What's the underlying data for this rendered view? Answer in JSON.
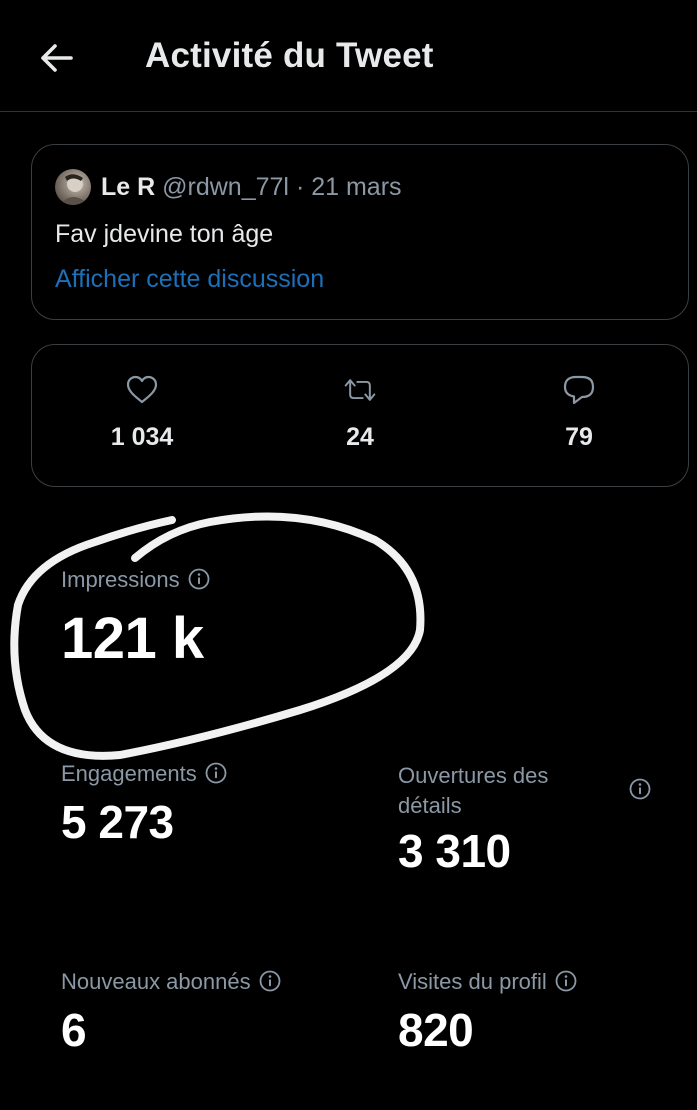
{
  "header": {
    "back_icon": "arrow-left-icon",
    "title": "Activité du Tweet"
  },
  "tweet": {
    "avatar_icon": "user-avatar",
    "name": "Le R",
    "handle": "@rdwn_77l",
    "separator": "·",
    "date": "21 mars",
    "text": "Fav jdevine ton âge",
    "link_label": "Afficher cette discussion",
    "link_color": "#1d6fb8"
  },
  "stats": {
    "likes": {
      "icon": "heart-icon",
      "count": "1 034"
    },
    "retweets": {
      "icon": "retweet-icon",
      "count": "24"
    },
    "replies": {
      "icon": "reply-bubble-icon",
      "count": "79"
    }
  },
  "metrics": {
    "impressions": {
      "label": "Impressions",
      "value": "121 k"
    },
    "engagements": {
      "label": "Engagements",
      "value": "5 273"
    },
    "detail_expands": {
      "label": "Ouvertures des détails",
      "label_line1": "Ouvertures des",
      "label_line2": "détails",
      "value": "3 310"
    },
    "new_followers": {
      "label": "Nouveaux abonnés",
      "value": "6"
    },
    "profile_visits": {
      "label": "Visites du profil",
      "value": "820"
    }
  },
  "annotation": {
    "type": "hand-drawn-circle",
    "color": "#ffffff"
  },
  "colors": {
    "background": "#000000",
    "text": "#e7e9ea",
    "secondary": "#8b98a5",
    "border": "#3a3f44"
  }
}
